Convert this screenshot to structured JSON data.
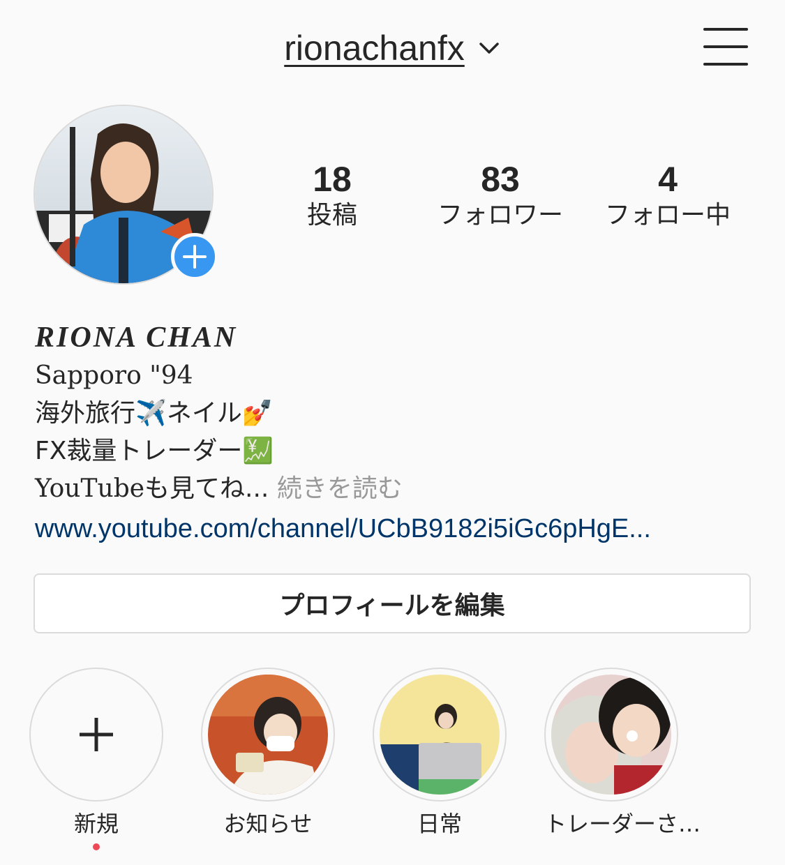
{
  "header": {
    "username": "rionachanfx"
  },
  "stats": [
    {
      "value": "18",
      "label": "投稿"
    },
    {
      "value": "83",
      "label": "フォロワー"
    },
    {
      "value": "4",
      "label": "フォロー中"
    }
  ],
  "profile": {
    "name": "RIONA CHAN",
    "bio": {
      "line1": "Sapporo \"94",
      "line2_text": "海外旅行",
      "line2_emoji1": "✈️",
      "line2_text2": "ネイル",
      "line2_emoji2": "💅",
      "line3_text": "FX裁量トレーダー",
      "line3_emoji": "💹",
      "line4_latin": "YouTube",
      "line4_text": "も見てね...",
      "read_more": "続きを読む"
    },
    "link": "www.youtube.com/channel/UCbB9182i5iGc6pHgE..."
  },
  "edit_profile_label": "プロフィールを編集",
  "highlights": [
    {
      "label": "新規",
      "icon": "plus-icon",
      "new_dot": true
    },
    {
      "label": "お知らせ"
    },
    {
      "label": "日常"
    },
    {
      "label": "トレーダーさ…"
    }
  ],
  "colors": {
    "accent": "#3897f0",
    "link": "#003569",
    "muted": "#999999",
    "dot": "#ed4956"
  }
}
